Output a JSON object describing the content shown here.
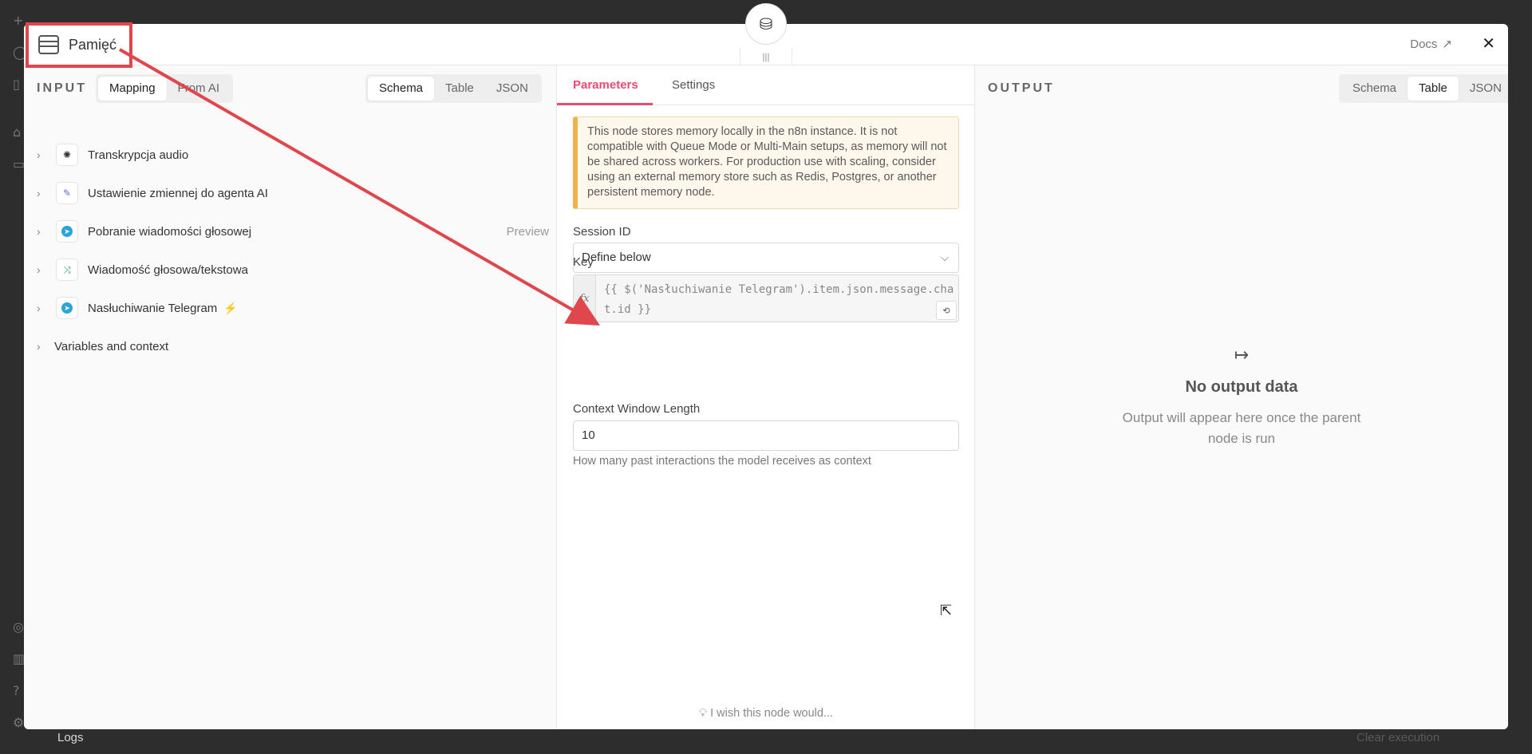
{
  "modal": {
    "title": "Pamięć",
    "docs_label": "Docs",
    "close_icon": "close-icon"
  },
  "input": {
    "label": "INPUT",
    "mode_tabs": [
      "Mapping",
      "From AI"
    ],
    "view_tabs": [
      "Schema",
      "Table",
      "JSON"
    ],
    "active_view": "Schema",
    "nodes": [
      {
        "label": "Transkrypcja audio",
        "icon": "openai-icon"
      },
      {
        "label": "Ustawienie zmiennej do agenta AI",
        "icon": "edit-icon"
      },
      {
        "label": "Pobranie wiadomości głosowej",
        "icon": "telegram-icon",
        "preview": "Preview"
      },
      {
        "label": "Wiadomość głosowa/tekstowa",
        "icon": "switch-icon"
      },
      {
        "label": "Nasłuchiwanie Telegram",
        "icon": "telegram-icon",
        "trigger": true
      }
    ],
    "variables_label": "Variables and context"
  },
  "params": {
    "tabs": [
      "Parameters",
      "Settings"
    ],
    "notice": "This node stores memory locally in the n8n instance. It is not compatible with Queue Mode or Multi-Main setups, as memory will not be shared across workers. For production use with scaling, consider using an external memory store such as Redis, Postgres, or another persistent memory node.",
    "session_id_label": "Session ID",
    "session_id_value": "Define below",
    "key_label": "Key",
    "key_value": "{{ $('Nasłuchiwanie Telegram').item.json.message.chat.id }}",
    "context_label": "Context Window Length",
    "context_value": "10",
    "context_hint": "How many past interactions the model receives as context",
    "wish": "I wish this node would..."
  },
  "output": {
    "label": "OUTPUT",
    "view_tabs": [
      "Schema",
      "Table",
      "JSON"
    ],
    "active_view": "Table",
    "empty_title": "No output data",
    "empty_sub": "Output will appear here once the parent node is run"
  },
  "background": {
    "logs_label": "Logs",
    "clear_label": "Clear execution"
  },
  "colors": {
    "accent": "#ea4b71",
    "annotation": "#e0474c",
    "notice_border": "#efb24a"
  }
}
